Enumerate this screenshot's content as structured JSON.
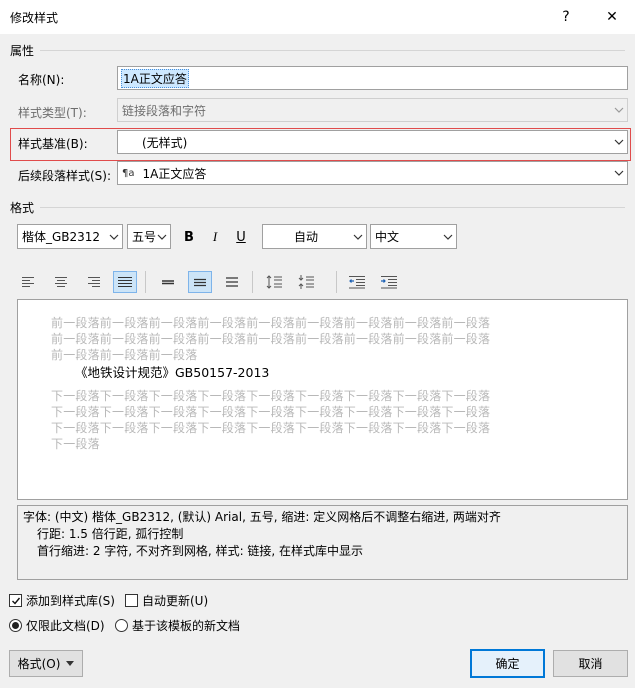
{
  "window": {
    "title": "修改样式",
    "help_label": "?",
    "close_label": "✕"
  },
  "properties": {
    "section_label": "属性",
    "name_label": "名称(N):",
    "name_value": "1A正文应答",
    "type_label": "样式类型(T):",
    "type_value": "链接段落和字符",
    "based_on_label": "样式基准(B):",
    "based_on_value": "(无样式)",
    "next_label": "后续段落样式(S):",
    "next_value": "1A正文应答",
    "next_icon_glyph": "¶a"
  },
  "format": {
    "section_label": "格式",
    "font_value": "楷体_GB2312",
    "size_value": "五号",
    "bold_label": "B",
    "italic_label": "I",
    "underline_label": "U",
    "color_value": "自动",
    "script_value": "中文"
  },
  "preview": {
    "prev_lines": [
      "前一段落前一段落前一段落前一段落前一段落前一段落前一段落前一段落前一段落",
      "前一段落前一段落前一段落前一段落前一段落前一段落前一段落前一段落前一段落",
      "前一段落前一段落前一段落"
    ],
    "sample_text": "《地铁设计规范》GB50157-2013",
    "next_lines": [
      "下一段落下一段落下一段落下一段落下一段落下一段落下一段落下一段落下一段落",
      "下一段落下一段落下一段落下一段落下一段落下一段落下一段落下一段落下一段落",
      "下一段落下一段落下一段落下一段落下一段落下一段落下一段落下一段落下一段落",
      "下一段落"
    ]
  },
  "description": {
    "line1": "字体: (中文) 楷体_GB2312, (默认) Arial, 五号, 缩进: 定义网格后不调整右缩进, 两端对齐",
    "line2": "行距: 1.5 倍行距, 孤行控制",
    "line3": "首行缩进:  2 字符, 不对齐到网格, 样式: 链接, 在样式库中显示"
  },
  "options": {
    "add_to_gallery_label": "添加到样式库(S)",
    "add_to_gallery_checked": true,
    "auto_update_label": "自动更新(U)",
    "auto_update_checked": false,
    "only_this_doc_label": "仅限此文档(D)",
    "new_docs_label": "基于该模板的新文档"
  },
  "buttons": {
    "format_label": "格式(O)",
    "ok_label": "确定",
    "cancel_label": "取消"
  }
}
